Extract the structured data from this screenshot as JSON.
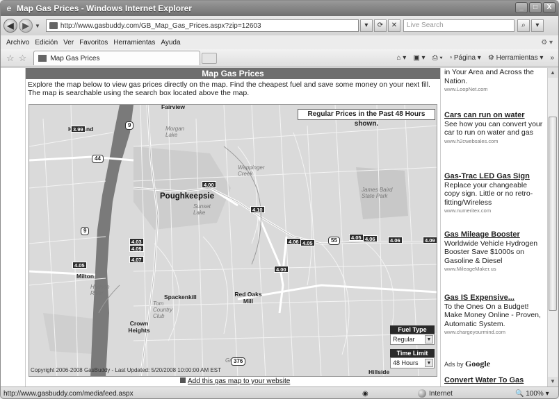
{
  "window": {
    "title": "Map Gas Prices - Windows Internet Explorer",
    "url": "http://www.gasbuddy.com/GB_Map_Gas_Prices.aspx?zip=12603",
    "search_placeholder": "Live Search"
  },
  "menu": {
    "items": [
      "Archivo",
      "Edición",
      "Ver",
      "Favoritos",
      "Herramientas",
      "Ayuda"
    ]
  },
  "tab": {
    "label": "Map Gas Prices"
  },
  "commands": {
    "page": "Página",
    "tools": "Herramientas"
  },
  "page": {
    "heading": "Map Gas Prices",
    "intro": "Explore the map below to view gas prices directly on the map. Find the cheapest fuel and save some money on your next fill. The map is searchable using the search box located above the map.",
    "map_notice": "Regular Prices in the Past 48 Hours shown.",
    "copyright": "Copyright 2006-2008 GasBuddy - Last Updated: 5/20/2008 10:00:00 AM EST",
    "add_link": "Add this gas map to your website",
    "fuel_type_label": "Fuel Type",
    "fuel_type_value": "Regular",
    "time_limit_label": "Time Limit",
    "time_limit_value": "48 Hours"
  },
  "map": {
    "places": {
      "fairview": "Fairview",
      "highland": "Highland",
      "morgan_lake": "Morgan Lake",
      "poughkeepsie": "Poughkeepsie",
      "sunset_lake": "Sunset Lake",
      "wappinger_creek": "Wappinger Creek",
      "james_baird": "James Baird State Park",
      "milton": "Milton",
      "hudson_river": "Hudson River",
      "spackenkill": "Spackenkill",
      "red_oaks_mill": "Red Oaks Mill",
      "tom_country": "Tom Country Club",
      "crown_heights": "Crown Heights",
      "greens": "Greens",
      "hillside": "Hillside"
    },
    "shields": {
      "r9a": "9",
      "r44": "44",
      "r9b": "9",
      "r55": "55",
      "r376": "376"
    },
    "prices": {
      "p_highland": "3.99",
      "p_400": "4.00",
      "p_410": "4.10",
      "p_406": "4.06",
      "p_405": "4.05",
      "p_405b": "4.05",
      "p_406b": "4.06",
      "p_409": "4.09",
      "p_403": "4.03",
      "p_409b": "4.09",
      "p_407": "4.07",
      "p_milton": "4.05",
      "p_400b": "4.00"
    }
  },
  "ads": [
    {
      "title": "",
      "body": "in Your Area and Across the Nation.",
      "url": "www.LoopNet.com"
    },
    {
      "title": "Cars can run on water",
      "body": "See how you can convert your car to run on water and gas",
      "url": "www.h2cwebsales.com"
    },
    {
      "title": "Gas-Trac LED Gas Sign",
      "body": "Replace your changeable copy sign. Little or no retro-fitting/Wireless",
      "url": "www.numeritex.com"
    },
    {
      "title": "Gas Mileage Booster",
      "body": "Worldwide Vehicle Hydrogen Booster Save $1000s on Gasoline & Diesel",
      "url": "www.MileageMaker.us"
    },
    {
      "title": "Gas IS Expensive...",
      "body": "To the Ones On a Budget! Make Money Online - Proven, Automatic System.",
      "url": "www.chargeyourmind.com"
    },
    {
      "title": "Convert Water To Gas",
      "body": "",
      "url": ""
    }
  ],
  "ads_by": {
    "prefix": "Ads by",
    "brand": "Google"
  },
  "status": {
    "url": "http://www.gasbuddy.com/mediafeed.aspx",
    "zone": "Internet",
    "zoom": "100%"
  }
}
